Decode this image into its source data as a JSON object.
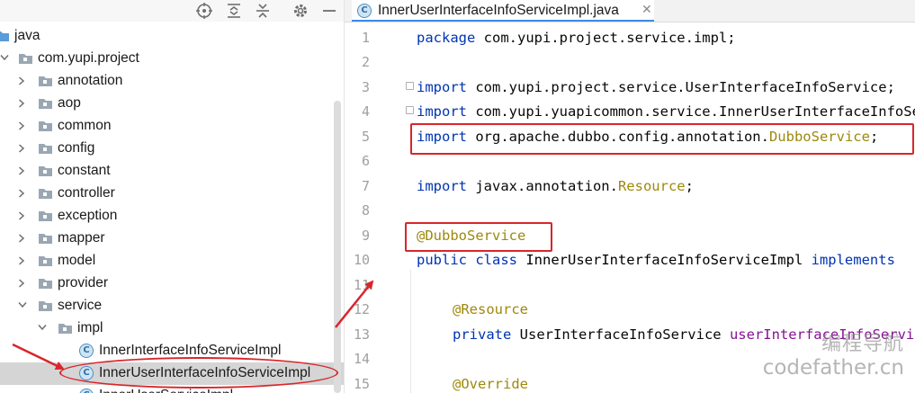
{
  "project_panel": {
    "toolbar_icons": [
      "locate-icon",
      "expand-all-icon",
      "collapse-all-icon",
      "gear-icon",
      "minimize-icon"
    ],
    "tree": [
      {
        "label": "java",
        "type": "folder",
        "depth": 0,
        "expanded": true
      },
      {
        "label": "com.yupi.project",
        "type": "package",
        "depth": 0,
        "expanded": true
      },
      {
        "label": "annotation",
        "type": "package",
        "depth": 1,
        "expanded": false
      },
      {
        "label": "aop",
        "type": "package",
        "depth": 1,
        "expanded": false
      },
      {
        "label": "common",
        "type": "package",
        "depth": 1,
        "expanded": false
      },
      {
        "label": "config",
        "type": "package",
        "depth": 1,
        "expanded": false
      },
      {
        "label": "constant",
        "type": "package",
        "depth": 1,
        "expanded": false
      },
      {
        "label": "controller",
        "type": "package",
        "depth": 1,
        "expanded": false
      },
      {
        "label": "exception",
        "type": "package",
        "depth": 1,
        "expanded": false
      },
      {
        "label": "mapper",
        "type": "package",
        "depth": 1,
        "expanded": false
      },
      {
        "label": "model",
        "type": "package",
        "depth": 1,
        "expanded": false
      },
      {
        "label": "provider",
        "type": "package",
        "depth": 1,
        "expanded": false
      },
      {
        "label": "service",
        "type": "package",
        "depth": 1,
        "expanded": true
      },
      {
        "label": "impl",
        "type": "package",
        "depth": 2,
        "expanded": true
      },
      {
        "label": "InnerInterfaceInfoServiceImpl",
        "type": "class",
        "depth": 3
      },
      {
        "label": "InnerUserInterfaceInfoServiceImpl",
        "type": "class",
        "depth": 3,
        "selected": true
      },
      {
        "label": "InnerUserServiceImpl",
        "type": "class",
        "depth": 3
      }
    ]
  },
  "editor": {
    "tab": {
      "title": "InnerUserInterfaceInfoServiceImpl.java",
      "close": "✕"
    },
    "line_numbers": [
      "1",
      "2",
      "3",
      "4",
      "5",
      "6",
      "7",
      "8",
      "9",
      "10",
      "11",
      "12",
      "13",
      "14",
      "15"
    ],
    "lines": {
      "l1_kw": "package ",
      "l1_rest": "com.yupi.project.service.impl;",
      "l3_kw": "import ",
      "l3_rest": "com.yupi.project.service.UserInterfaceInfoService;",
      "l4_kw": "import ",
      "l4_rest": "com.yupi.yuapicommon.service.InnerUserInterfaceInfoService;",
      "l5_kw": "import ",
      "l5_rest": "org.apache.dubbo.config.annotation.",
      "l5_cls": "DubboService",
      "l5_end": ";",
      "l7_kw": "import ",
      "l7_rest": "javax.annotation.",
      "l7_cls": "Resource",
      "l7_end": ";",
      "l9_ann": "@DubboService",
      "l10_kw": "public class ",
      "l10_name": "InnerUserInterfaceInfoServiceImpl ",
      "l10_kw2": "implements",
      "l12_ann": "@Resource",
      "l13_kw": "private ",
      "l13_type": "UserInterfaceInfoService ",
      "l13_field": "userInterfaceInfoService;",
      "l15_ann": "@Override"
    }
  },
  "watermark": {
    "line1": "编程导航",
    "line2": "codefather.cn"
  },
  "colors": {
    "annotation_red": "#d8262b",
    "keyword": "#0033b3",
    "annotation": "#9e880d",
    "field": "#871094",
    "selection": "#d5d5d5",
    "tab_underline": "#3d8be8"
  }
}
